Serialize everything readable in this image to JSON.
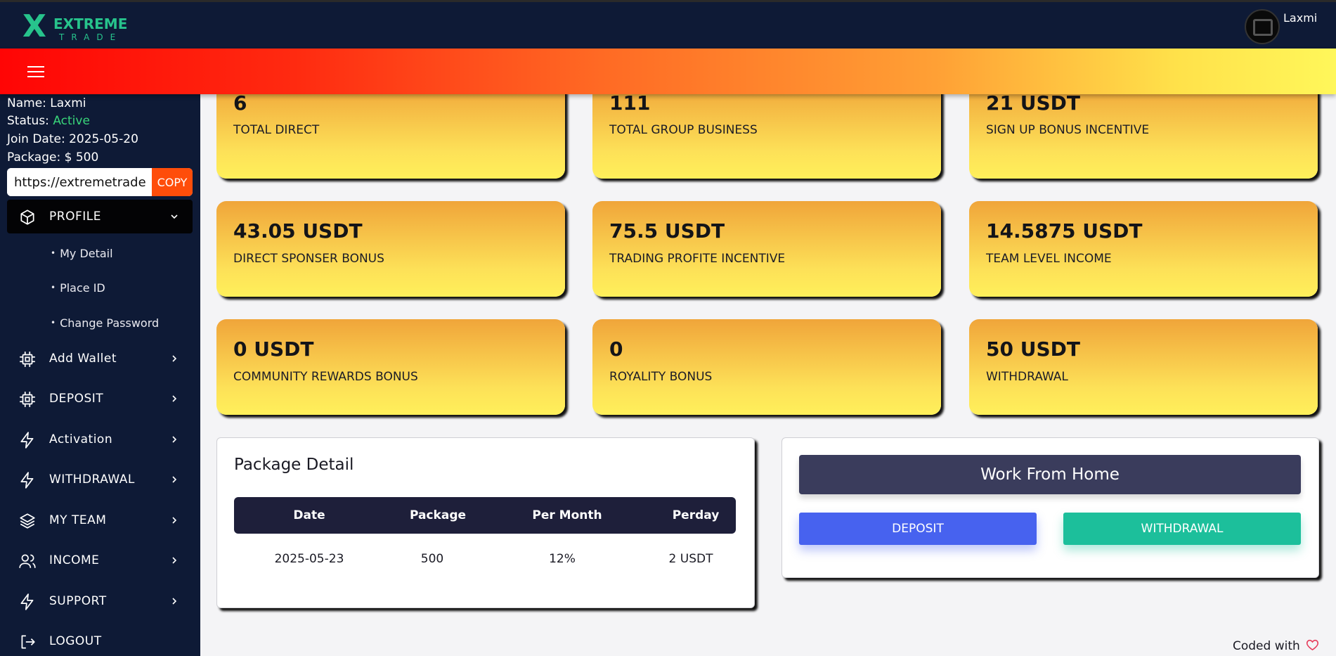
{
  "brand": {
    "logo_text": "EXTREME",
    "logo_sub": "TRADE",
    "logo_mark": "X"
  },
  "header": {
    "username": "Laxmi"
  },
  "user_info": {
    "name_label": "Name:",
    "name_value": "Laxmi",
    "status_label": "Status:",
    "status_value": "Active",
    "join_label": "Join Date:",
    "join_value": "2025-05-20",
    "package_label": "Package:",
    "package_value": "$ 500"
  },
  "referral": {
    "value": "https://extremetrade",
    "copy_label": "COPY"
  },
  "menu": {
    "profile": "PROFILE",
    "profile_sub": [
      "My Detail",
      "Place ID",
      "Change Password"
    ],
    "items": [
      "Add Wallet",
      "DEPOSIT",
      "Activation",
      "WITHDRAWAL",
      "MY TEAM",
      "INCOME",
      "SUPPORT",
      "LOGOUT"
    ]
  },
  "cards": [
    {
      "value": "6",
      "label": "TOTAL DIRECT"
    },
    {
      "value": "111",
      "label": "TOTAL GROUP BUSINESS"
    },
    {
      "value": "21 USDT",
      "label": "SIGN UP BONUS INCENTIVE"
    },
    {
      "value": "43.05 USDT",
      "label": "DIRECT SPONSER BONUS"
    },
    {
      "value": "75.5 USDT",
      "label": "TRADING PROFITE INCENTIVE"
    },
    {
      "value": "14.5875 USDT",
      "label": "TEAM LEVEL INCOME"
    },
    {
      "value": "0 USDT",
      "label": "COMMUNITY REWARDS BONUS"
    },
    {
      "value": "0",
      "label": "ROYALITY BONUS"
    },
    {
      "value": "50 USDT",
      "label": "WITHDRAWAL"
    }
  ],
  "package_detail": {
    "title": "Package Detail",
    "columns": [
      "Date",
      "Package",
      "Per Month",
      "Perday"
    ],
    "rows": [
      [
        "2025-05-23",
        "500",
        "12%",
        "2 USDT"
      ]
    ]
  },
  "actions": {
    "title": "Work From Home",
    "deposit": "DEPOSIT",
    "withdrawal": "WITHDRAWAL"
  },
  "footer": {
    "text": "Coded with"
  },
  "colors": {
    "sidebar": "#0e1a36",
    "accent_orange": "#ff4d0a",
    "deposit_btn": "#4762ef",
    "withdraw_btn": "#1cbf9b",
    "status_active": "#39d67a"
  }
}
